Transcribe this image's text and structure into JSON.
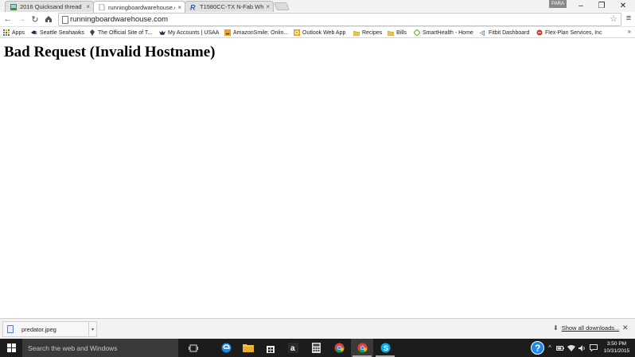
{
  "tabs": [
    {
      "title": "2016 Quicksand thread | T"
    },
    {
      "title": "runningboardwarehouse.c"
    },
    {
      "title": "T1580CC-TX N-Fab Wheel"
    }
  ],
  "profile_label": "PARA",
  "address_bar": {
    "url": "runningboardwarehouse.com"
  },
  "bookmarks": [
    {
      "label": "Apps"
    },
    {
      "label": "Seattle Seahawks"
    },
    {
      "label": "The Official Site of T..."
    },
    {
      "label": "My Accounts | USAA"
    },
    {
      "label": "AmazonSmile: Onlin..."
    },
    {
      "label": "Outlook Web App"
    },
    {
      "label": "Recipes"
    },
    {
      "label": "Bills"
    },
    {
      "label": "SmartHealth - Home"
    },
    {
      "label": "Fitbit Dashboard"
    },
    {
      "label": "Flex-Plan Services, Inc"
    }
  ],
  "page": {
    "heading": "Bad Request (Invalid Hostname)"
  },
  "downloads": {
    "file_name": "predator.jpeg",
    "show_all_label": "Show all downloads..."
  },
  "taskbar": {
    "search_placeholder": "Search the web and Windows",
    "time": "3:50 PM",
    "date": "10/31/2015"
  },
  "colors": {
    "taskbar_bg": "#1c1c1c",
    "tab_strip_bg": "#f2f2f2",
    "accent_blue": "#1e88e5"
  }
}
